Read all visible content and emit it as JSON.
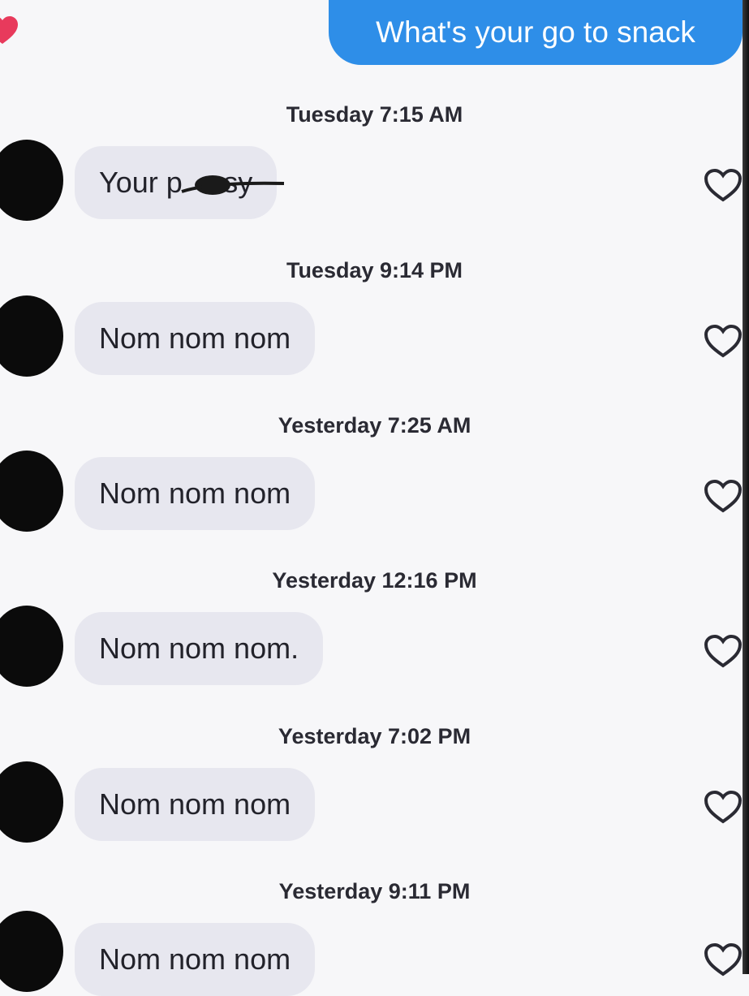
{
  "outgoing_message": "What's your go to snack",
  "messages": [
    {
      "timestamp": "Tuesday 7:15 AM",
      "text": "Your p       sy"
    },
    {
      "timestamp": "Tuesday 9:14 PM",
      "text": "Nom nom nom"
    },
    {
      "timestamp": "Yesterday 7:25 AM",
      "text": "Nom nom nom"
    },
    {
      "timestamp": "Yesterday 12:16 PM",
      "text": "Nom nom nom."
    },
    {
      "timestamp": "Yesterday 7:02 PM",
      "text": "Nom nom nom"
    },
    {
      "timestamp": "Yesterday 9:11 PM",
      "text": "Nom nom nom"
    }
  ],
  "icons": {
    "like": "heart-outline-icon",
    "badge": "heart-filled-icon"
  },
  "colors": {
    "outgoing_bubble": "#2e8ee8",
    "incoming_bubble": "#e7e7ef",
    "badge_heart": "#e83a5c"
  }
}
